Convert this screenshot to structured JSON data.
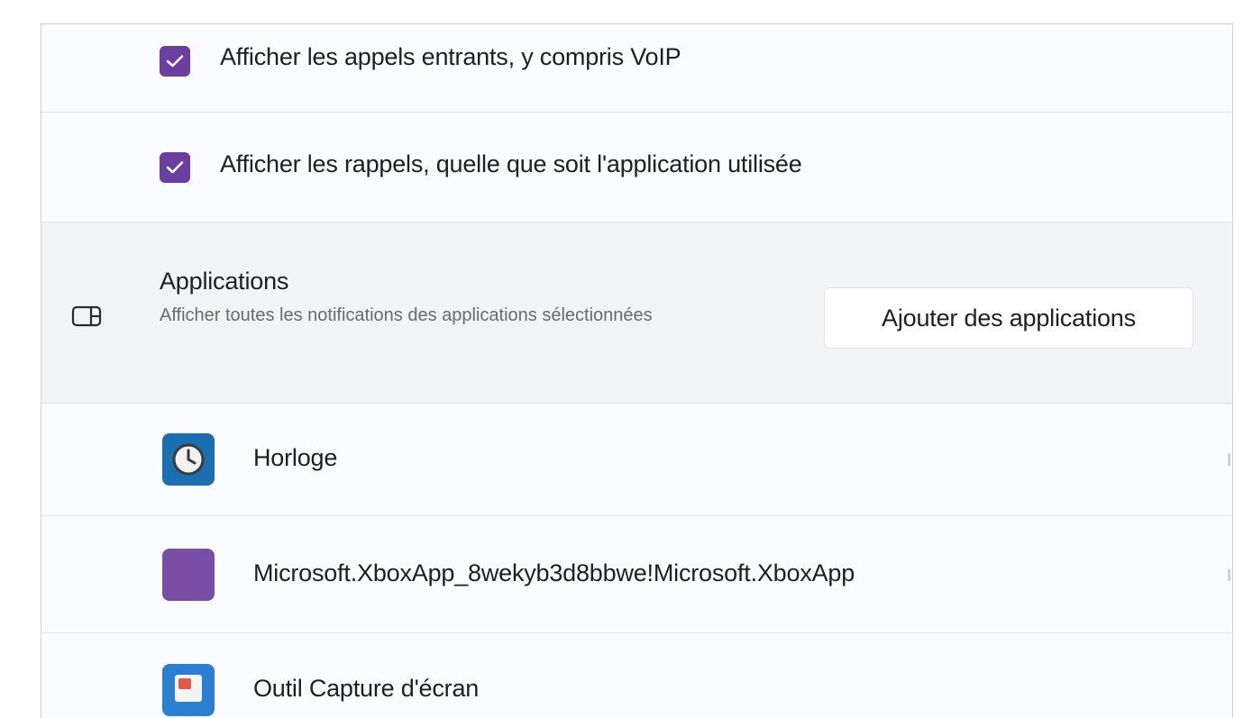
{
  "checkboxes": [
    {
      "label": "Afficher les appels entrants, y compris VoIP",
      "checked": true
    },
    {
      "label": "Afficher les rappels, quelle que soit l'application utilisée",
      "checked": true
    }
  ],
  "applications_section": {
    "icon": "app-window-icon",
    "title": "Applications",
    "description": "Afficher toutes les notifications des applications sélectionnées",
    "add_button": "Ajouter des applications"
  },
  "apps": [
    {
      "name": "Horloge",
      "icon": "clock-app-icon"
    },
    {
      "name": "Microsoft.XboxApp_8wekyb3d8bbwe!Microsoft.XboxApp",
      "icon": "xbox-app-icon"
    },
    {
      "name": "Outil Capture d'écran",
      "icon": "snipping-tool-icon"
    }
  ],
  "colors": {
    "accent": "#6b3fa0",
    "clock_icon": "#1b6fb0",
    "xbox_icon": "#7a4ea6",
    "snip_icon": "#2a7fd0"
  }
}
